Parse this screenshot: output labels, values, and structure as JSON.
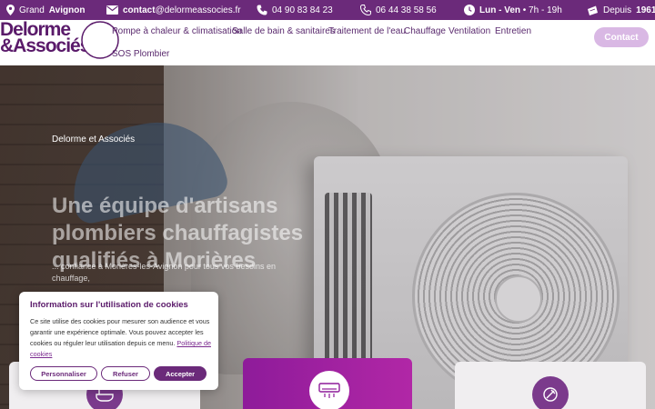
{
  "topbar": {
    "location_prefix": "Grand",
    "location_bold": "Avignon",
    "email_label": "contact",
    "email_rest": "@delormeassocies.fr",
    "phone1": "04 90 83 84 23",
    "phone2": "06 44 38 58 56",
    "hours_bold": "Lun - Ven",
    "hours_rest": " • 7h - 19h",
    "since_prefix": "Depuis",
    "since_year": "1961"
  },
  "logo": {
    "line1": "Delorme",
    "line2": "&Associés"
  },
  "nav": {
    "items": [
      "Pompe à chaleur & climatisation",
      "Salle de bain & sanitaires",
      "Traitement de l'eau",
      "Chauffage",
      "Ventilation",
      "Entretien",
      "SOS Plombier"
    ],
    "contact": "Contact"
  },
  "hero": {
    "kicker": "Delorme et Associés",
    "title": "Une équipe d'artisans plombiers chauffagistes qualifiés à Morières",
    "subtitle": "... confiance à Morières-les-Avignon pour tous vos besoins en chauffage,"
  },
  "cookie": {
    "title": "Information sur l'utilisation de cookies",
    "body": "Ce site utilise des cookies pour mesurer son audience et vous garantir une expérience optimale. Vous pouvez accepter les cookies ou réguler leur utilisation depuis ce menu.",
    "policy_link": "Politique de cookies",
    "customize": "Personnaliser",
    "refuse": "Refuser",
    "accept": "Accepter"
  },
  "colors": {
    "brand_purple": "#6b2a7a",
    "card_gradient_start": "#8e1b9a",
    "card_gradient_end": "#b127a6"
  },
  "icons": [
    "location-pin-icon",
    "envelope-icon",
    "phone-icon",
    "mobile-phone-icon",
    "clock-icon",
    "badge-icon",
    "bathtub-icon",
    "air-conditioner-icon",
    "maintenance-icon"
  ]
}
